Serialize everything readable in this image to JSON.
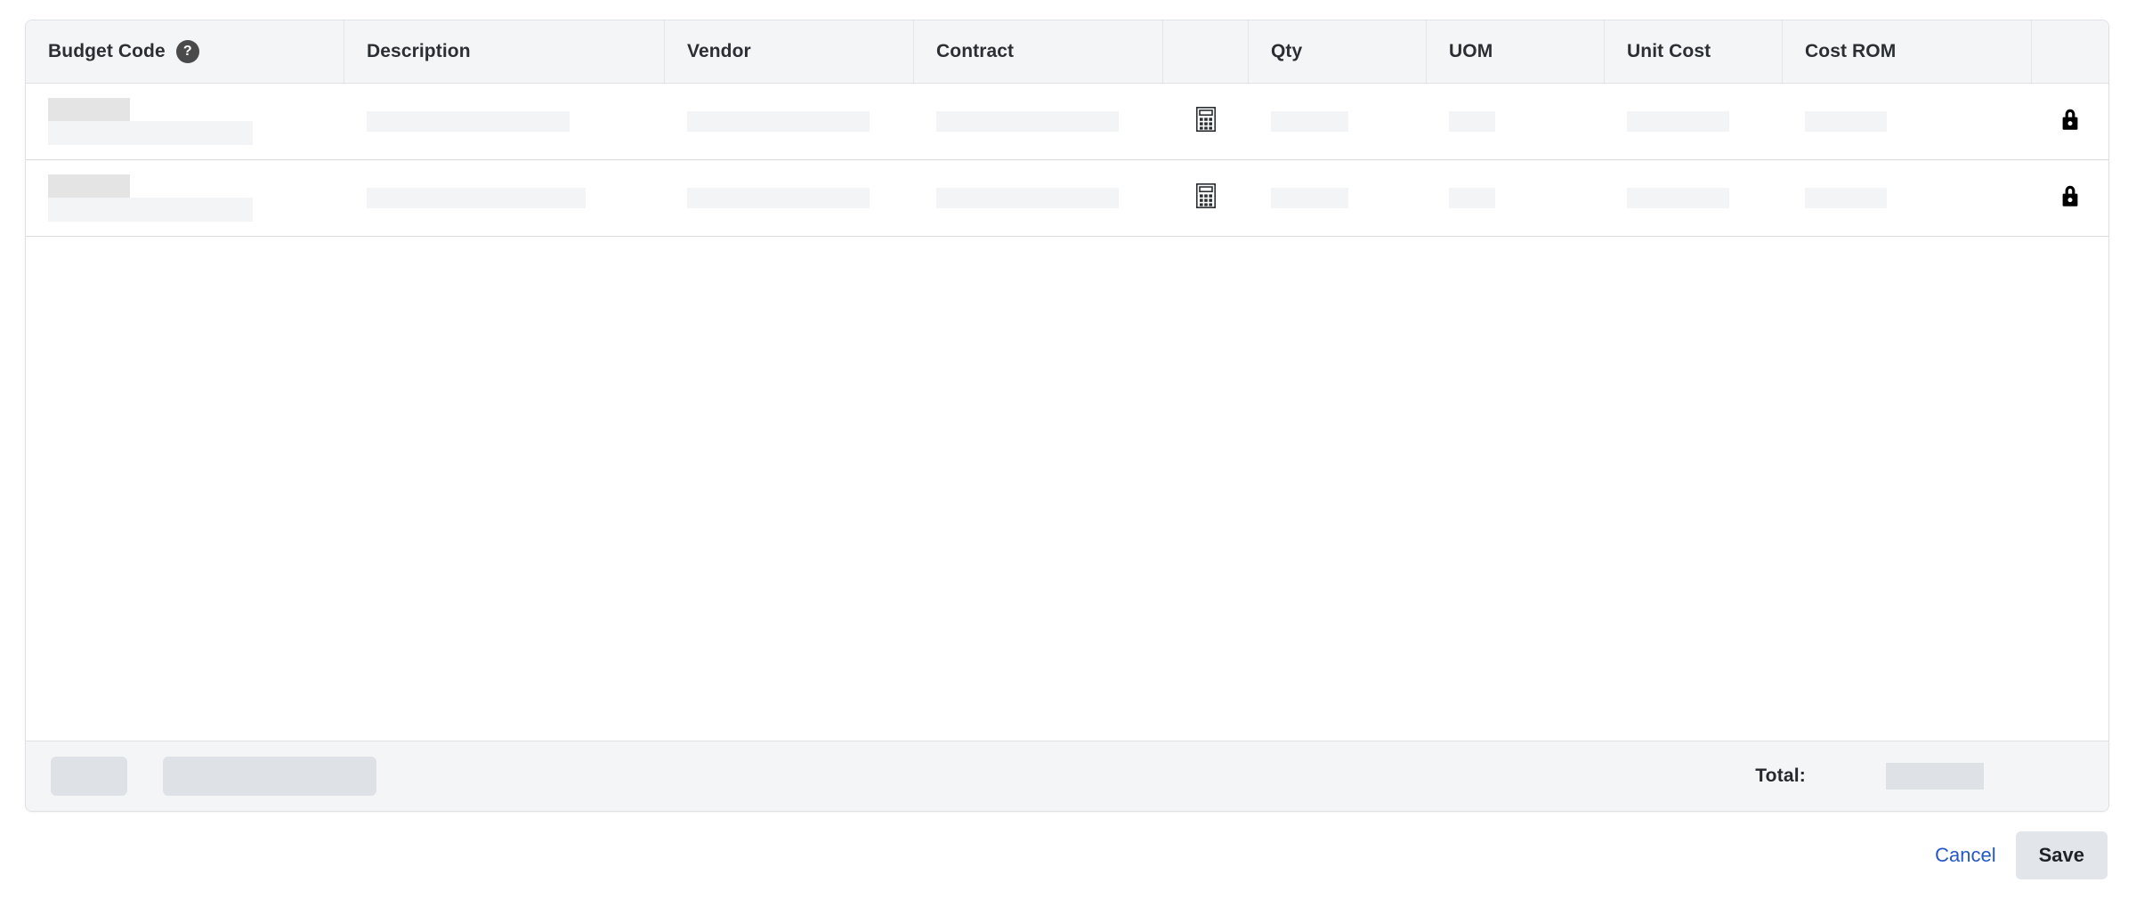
{
  "table": {
    "columns": [
      {
        "key": "budget_code",
        "label": "Budget Code",
        "help_icon": "help-icon",
        "help_glyph": "?"
      },
      {
        "key": "description",
        "label": "Description"
      },
      {
        "key": "vendor",
        "label": "Vendor"
      },
      {
        "key": "contract",
        "label": "Contract"
      },
      {
        "key": "calculator",
        "label": ""
      },
      {
        "key": "qty",
        "label": "Qty"
      },
      {
        "key": "uom",
        "label": "UOM"
      },
      {
        "key": "unit_cost",
        "label": "Unit Cost"
      },
      {
        "key": "cost_rom",
        "label": "Cost ROM"
      },
      {
        "key": "lock",
        "label": ""
      }
    ],
    "rows": [
      {
        "budget_code": "",
        "description": "",
        "vendor": "",
        "contract": "",
        "calculator_icon": "calculator-icon",
        "qty": "",
        "uom": "",
        "unit_cost": "",
        "cost_rom": "",
        "lock_icon": "lock-icon"
      },
      {
        "budget_code": "",
        "description": "",
        "vendor": "",
        "contract": "",
        "calculator_icon": "calculator-icon",
        "qty": "",
        "uom": "",
        "unit_cost": "",
        "cost_rom": "",
        "lock_icon": "lock-icon"
      }
    ],
    "loading": true
  },
  "footer": {
    "total_label": "Total:",
    "total_value": ""
  },
  "actions": {
    "cancel_label": "Cancel",
    "save_label": "Save"
  },
  "colors": {
    "header_bg": "#f4f5f7",
    "border": "#dfe1e5",
    "skeleton_light": "#f2f4f6",
    "skeleton_medium": "#e4e4e4",
    "skeleton_dark": "#dee2e6",
    "link": "#2558c4",
    "text": "#2b2f33",
    "save_bg": "#e2e5e9"
  }
}
